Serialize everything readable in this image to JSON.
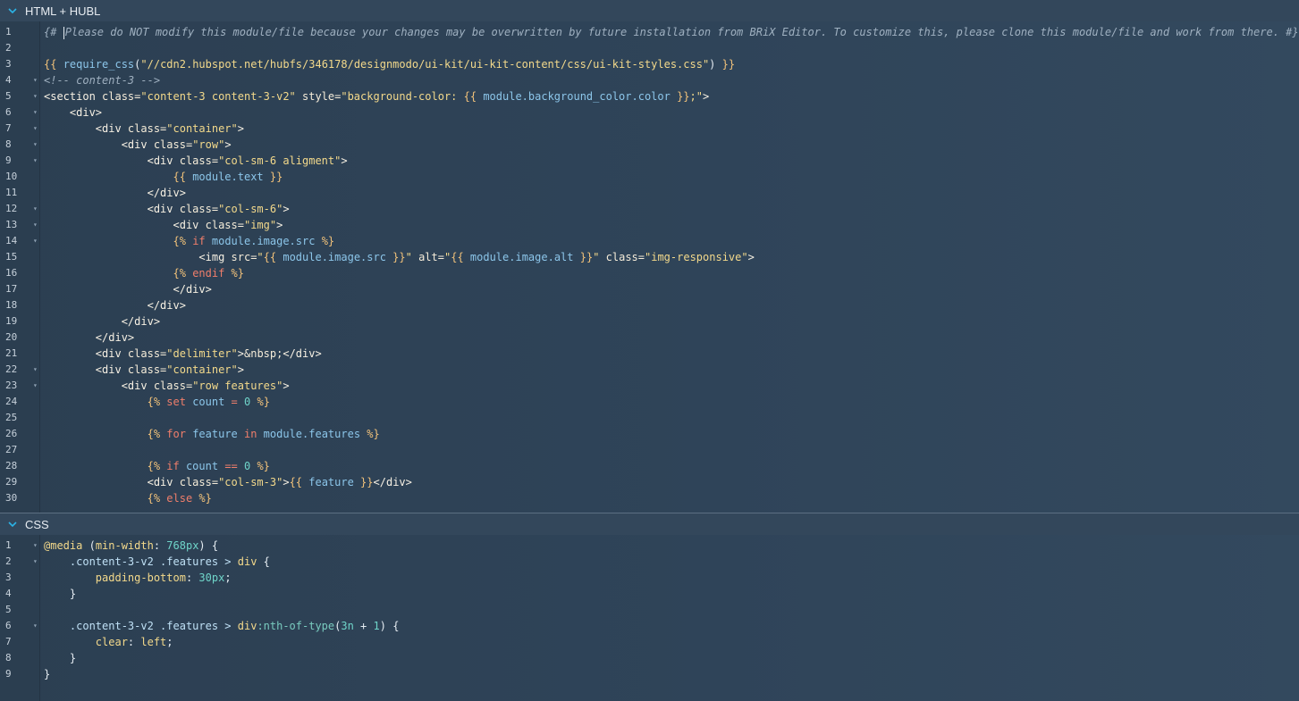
{
  "html_panel": {
    "title": "HTML + HUBL",
    "lines": [
      {
        "n": "1",
        "fold": false,
        "t": [
          [
            "cmt",
            "{# "
          ],
          [
            "cursor",
            ""
          ],
          [
            "cmt",
            "Please do NOT modify this module/file because your changes may be overwritten by future installation from BRiX Editor. To customize this, please clone this module/file and work from there. #}"
          ]
        ]
      },
      {
        "n": "2",
        "fold": false,
        "t": []
      },
      {
        "n": "3",
        "fold": false,
        "t": [
          [
            "hubl",
            "{{ "
          ],
          [
            "var",
            "require_css"
          ],
          [
            "punc",
            "("
          ],
          [
            "str",
            "\"//cdn2.hubspot.net/hubfs/346178/designmodo/ui-kit/ui-kit-content/css/ui-kit-styles.css\""
          ],
          [
            "punc",
            ")"
          ],
          [
            "hubl",
            " }}"
          ]
        ]
      },
      {
        "n": "4",
        "fold": true,
        "t": [
          [
            "cmt",
            "<!-- content-3 -->"
          ]
        ]
      },
      {
        "n": "5",
        "fold": true,
        "t": [
          [
            "tag",
            "<section "
          ],
          [
            "attr",
            "class="
          ],
          [
            "str",
            "\"content-3 content-3-v2\""
          ],
          [
            "attr",
            " style="
          ],
          [
            "str",
            "\"background-color: "
          ],
          [
            "hubl",
            "{{ "
          ],
          [
            "var",
            "module.background_color.color"
          ],
          [
            "hubl",
            " }}"
          ],
          [
            "str",
            ";\""
          ],
          [
            "tag",
            ">"
          ]
        ]
      },
      {
        "n": "6",
        "fold": true,
        "t": [
          [
            "punc",
            "    "
          ],
          [
            "tag",
            "<div>"
          ]
        ]
      },
      {
        "n": "7",
        "fold": true,
        "t": [
          [
            "punc",
            "        "
          ],
          [
            "tag",
            "<div "
          ],
          [
            "attr",
            "class="
          ],
          [
            "str",
            "\"container\""
          ],
          [
            "tag",
            ">"
          ]
        ]
      },
      {
        "n": "8",
        "fold": true,
        "t": [
          [
            "punc",
            "            "
          ],
          [
            "tag",
            "<div "
          ],
          [
            "attr",
            "class="
          ],
          [
            "str",
            "\"row\""
          ],
          [
            "tag",
            ">"
          ]
        ]
      },
      {
        "n": "9",
        "fold": true,
        "t": [
          [
            "punc",
            "                "
          ],
          [
            "tag",
            "<div "
          ],
          [
            "attr",
            "class="
          ],
          [
            "str",
            "\"col-sm-6 aligment\""
          ],
          [
            "tag",
            ">"
          ]
        ]
      },
      {
        "n": "10",
        "fold": false,
        "t": [
          [
            "punc",
            "                    "
          ],
          [
            "hubl",
            "{{ "
          ],
          [
            "var",
            "module.text"
          ],
          [
            "hubl",
            " }}"
          ]
        ]
      },
      {
        "n": "11",
        "fold": false,
        "t": [
          [
            "punc",
            "                "
          ],
          [
            "tag",
            "</div>"
          ]
        ]
      },
      {
        "n": "12",
        "fold": true,
        "t": [
          [
            "punc",
            "                "
          ],
          [
            "tag",
            "<div "
          ],
          [
            "attr",
            "class="
          ],
          [
            "str",
            "\"col-sm-6\""
          ],
          [
            "tag",
            ">"
          ]
        ]
      },
      {
        "n": "13",
        "fold": true,
        "t": [
          [
            "punc",
            "                    "
          ],
          [
            "tag",
            "<div "
          ],
          [
            "attr",
            "class="
          ],
          [
            "str",
            "\"img\""
          ],
          [
            "tag",
            ">"
          ]
        ]
      },
      {
        "n": "14",
        "fold": true,
        "t": [
          [
            "punc",
            "                    "
          ],
          [
            "hubl",
            "{% "
          ],
          [
            "kw",
            "if"
          ],
          [
            "var",
            " module.image.src"
          ],
          [
            "hubl",
            " %}"
          ]
        ]
      },
      {
        "n": "15",
        "fold": false,
        "t": [
          [
            "punc",
            "                        "
          ],
          [
            "tag",
            "<img "
          ],
          [
            "attr",
            "src="
          ],
          [
            "str",
            "\""
          ],
          [
            "hubl",
            "{{ "
          ],
          [
            "var",
            "module.image.src"
          ],
          [
            "hubl",
            " }}"
          ],
          [
            "str",
            "\""
          ],
          [
            "attr",
            " alt="
          ],
          [
            "str",
            "\""
          ],
          [
            "hubl",
            "{{ "
          ],
          [
            "var",
            "module.image.alt"
          ],
          [
            "hubl",
            " }}"
          ],
          [
            "str",
            "\""
          ],
          [
            "attr",
            " class="
          ],
          [
            "str",
            "\"img-responsive\""
          ],
          [
            "tag",
            ">"
          ]
        ]
      },
      {
        "n": "16",
        "fold": false,
        "t": [
          [
            "punc",
            "                    "
          ],
          [
            "hubl",
            "{% "
          ],
          [
            "kw",
            "endif"
          ],
          [
            "hubl",
            " %}"
          ]
        ]
      },
      {
        "n": "17",
        "fold": false,
        "t": [
          [
            "punc",
            "                    "
          ],
          [
            "tag",
            "</div>"
          ]
        ]
      },
      {
        "n": "18",
        "fold": false,
        "t": [
          [
            "punc",
            "                "
          ],
          [
            "tag",
            "</div>"
          ]
        ]
      },
      {
        "n": "19",
        "fold": false,
        "t": [
          [
            "punc",
            "            "
          ],
          [
            "tag",
            "</div>"
          ]
        ]
      },
      {
        "n": "20",
        "fold": false,
        "t": [
          [
            "punc",
            "        "
          ],
          [
            "tag",
            "</div>"
          ]
        ]
      },
      {
        "n": "21",
        "fold": false,
        "t": [
          [
            "punc",
            "        "
          ],
          [
            "tag",
            "<div "
          ],
          [
            "attr",
            "class="
          ],
          [
            "str",
            "\"delimiter\""
          ],
          [
            "tag",
            ">"
          ],
          [
            "attr",
            "&nbsp;"
          ],
          [
            "tag",
            "</div>"
          ]
        ]
      },
      {
        "n": "22",
        "fold": true,
        "t": [
          [
            "punc",
            "        "
          ],
          [
            "tag",
            "<div "
          ],
          [
            "attr",
            "class="
          ],
          [
            "str",
            "\"container\""
          ],
          [
            "tag",
            ">"
          ]
        ]
      },
      {
        "n": "23",
        "fold": true,
        "t": [
          [
            "punc",
            "            "
          ],
          [
            "tag",
            "<div "
          ],
          [
            "attr",
            "class="
          ],
          [
            "str",
            "\"row features\""
          ],
          [
            "tag",
            ">"
          ]
        ]
      },
      {
        "n": "24",
        "fold": false,
        "t": [
          [
            "punc",
            "                "
          ],
          [
            "hubl",
            "{% "
          ],
          [
            "kw",
            "set"
          ],
          [
            "var",
            " count"
          ],
          [
            "kw",
            " = "
          ],
          [
            "num",
            "0"
          ],
          [
            "hubl",
            " %}"
          ]
        ]
      },
      {
        "n": "25",
        "fold": false,
        "t": []
      },
      {
        "n": "26",
        "fold": false,
        "t": [
          [
            "punc",
            "                "
          ],
          [
            "hubl",
            "{% "
          ],
          [
            "kw",
            "for"
          ],
          [
            "var",
            " feature"
          ],
          [
            "kw",
            " in"
          ],
          [
            "var",
            " module.features"
          ],
          [
            "hubl",
            " %}"
          ]
        ]
      },
      {
        "n": "27",
        "fold": false,
        "t": []
      },
      {
        "n": "28",
        "fold": false,
        "t": [
          [
            "punc",
            "                "
          ],
          [
            "hubl",
            "{% "
          ],
          [
            "kw",
            "if"
          ],
          [
            "var",
            " count"
          ],
          [
            "kw",
            " == "
          ],
          [
            "num",
            "0"
          ],
          [
            "hubl",
            " %}"
          ]
        ]
      },
      {
        "n": "29",
        "fold": false,
        "t": [
          [
            "punc",
            "                "
          ],
          [
            "tag",
            "<div "
          ],
          [
            "attr",
            "class="
          ],
          [
            "str",
            "\"col-sm-3\""
          ],
          [
            "tag",
            ">"
          ],
          [
            "hubl",
            "{{ "
          ],
          [
            "var",
            "feature"
          ],
          [
            "hubl",
            " }}"
          ],
          [
            "tag",
            "</div>"
          ]
        ]
      },
      {
        "n": "30",
        "fold": false,
        "t": [
          [
            "punc",
            "                "
          ],
          [
            "hubl",
            "{% "
          ],
          [
            "kw",
            "else"
          ],
          [
            "hubl",
            " %}"
          ]
        ]
      }
    ]
  },
  "css_panel": {
    "title": "CSS",
    "lines": [
      {
        "n": "1",
        "fold": true,
        "t": [
          [
            "prop",
            "@media"
          ],
          [
            "punc",
            " ("
          ],
          [
            "prop",
            "min-width"
          ],
          [
            "punc",
            ": "
          ],
          [
            "num",
            "768px"
          ],
          [
            "punc",
            ") {"
          ]
        ]
      },
      {
        "n": "2",
        "fold": true,
        "t": [
          [
            "punc",
            "    "
          ],
          [
            "sel",
            ".content-3-v2 .features > "
          ],
          [
            "val",
            "div"
          ],
          [
            "punc",
            " {"
          ]
        ]
      },
      {
        "n": "3",
        "fold": false,
        "t": [
          [
            "punc",
            "        "
          ],
          [
            "prop",
            "padding-bottom"
          ],
          [
            "punc",
            ": "
          ],
          [
            "num",
            "30px"
          ],
          [
            "punc",
            ";"
          ]
        ]
      },
      {
        "n": "4",
        "fold": false,
        "t": [
          [
            "punc",
            "    }"
          ]
        ]
      },
      {
        "n": "5",
        "fold": false,
        "t": []
      },
      {
        "n": "6",
        "fold": true,
        "t": [
          [
            "punc",
            "    "
          ],
          [
            "sel",
            ".content-3-v2 .features > "
          ],
          [
            "val",
            "div"
          ],
          [
            "pseudo",
            ":nth-of-type"
          ],
          [
            "punc",
            "("
          ],
          [
            "num",
            "3n"
          ],
          [
            "punc",
            " + "
          ],
          [
            "num",
            "1"
          ],
          [
            "punc",
            ") {"
          ]
        ]
      },
      {
        "n": "7",
        "fold": false,
        "t": [
          [
            "punc",
            "        "
          ],
          [
            "prop",
            "clear"
          ],
          [
            "punc",
            ": "
          ],
          [
            "val",
            "left"
          ],
          [
            "punc",
            ";"
          ]
        ]
      },
      {
        "n": "8",
        "fold": false,
        "t": [
          [
            "punc",
            "    }"
          ]
        ]
      },
      {
        "n": "9",
        "fold": false,
        "t": [
          [
            "punc",
            "}"
          ]
        ]
      }
    ]
  }
}
